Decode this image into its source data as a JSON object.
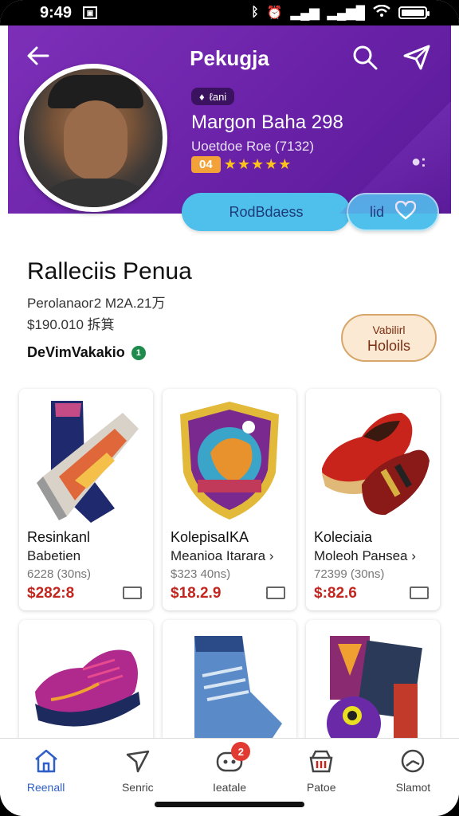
{
  "status": {
    "time": "9:49"
  },
  "header": {
    "title": "Pekugja"
  },
  "profile": {
    "tag": "ℓani",
    "name": "Margon Baha 298",
    "subtitle": "Uoetdoe Roe (7132)",
    "rating_badge": "04",
    "stars": "★★★★★",
    "dots": "●:"
  },
  "actions": {
    "main_label": "RodBdaess",
    "like_label": "lid"
  },
  "shop": {
    "name": "Ralleciis Penua",
    "meta": "Perolanaoг2 M2A.21万",
    "price": "$190.010 拆箕",
    "owner": "DeVimVakakio",
    "owner_badge": "1"
  },
  "side_button": {
    "line1": "Vabilirl",
    "line2": "Holoils"
  },
  "products": [
    {
      "title": "Resinkanl",
      "subtitle": "Babetien",
      "meta": "6228 (30ns)",
      "price": "$282:8"
    },
    {
      "title": "KolepisaIKA",
      "subtitle": "Meanioa Itarara ›",
      "meta": "$323 40ns)",
      "price": "$18.2.9"
    },
    {
      "title": "Koleciaia",
      "subtitle": "Moleoh Ранsеa ›",
      "meta": "72399 (30ns)",
      "price": "$:82.6"
    }
  ],
  "nav": [
    {
      "label": "Reenall",
      "icon": "home-icon"
    },
    {
      "label": "Senric",
      "icon": "send-icon"
    },
    {
      "label": "Ieatale",
      "icon": "camera-icon",
      "badge": "2"
    },
    {
      "label": "Patoe",
      "icon": "shop-icon"
    },
    {
      "label": "Slamot",
      "icon": "clock-icon"
    }
  ]
}
